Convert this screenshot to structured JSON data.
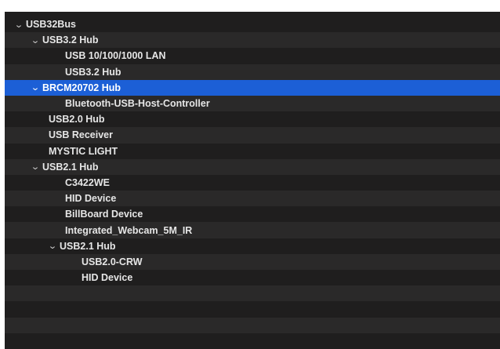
{
  "tree": {
    "root": "USB32Bus",
    "hub1": "USB3.2 Hub",
    "hub1_child1": "USB 10/100/1000 LAN",
    "hub1_child2": "USB3.2 Hub",
    "hub2": "BRCM20702 Hub",
    "hub2_child1": "Bluetooth-USB-Host-Controller",
    "dev1": "USB2.0 Hub",
    "dev2": "USB Receiver",
    "dev3": "MYSTIC LIGHT",
    "hub3": "USB2.1 Hub",
    "hub3_child1": "C3422WE",
    "hub3_child2": "HID Device",
    "hub3_child3": "BillBoard Device",
    "hub3_child4": "Integrated_Webcam_5M_IR",
    "hub4": "USB2.1 Hub",
    "hub4_child1": "USB2.0-CRW",
    "hub4_child2": "HID Device"
  },
  "icons": {
    "expanded": "chevron-down-icon"
  },
  "colors": {
    "background": "#1f1e1e",
    "alt_row": "#2a2929",
    "selection": "#1c5fd6",
    "text": "#e6e6e6"
  }
}
